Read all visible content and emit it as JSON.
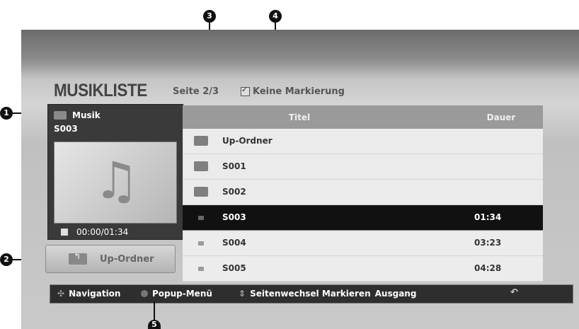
{
  "screen": {
    "title": "MUSIKLISTE",
    "page_info": "Seite 2/3",
    "mark_info": "Keine Markierung"
  },
  "preview": {
    "category": "Musik",
    "track": "S003",
    "time": "00:00/01:34"
  },
  "up_button": {
    "label": "Up-Ordner"
  },
  "list": {
    "headers": {
      "title": "Titel",
      "duration": "Dauer"
    },
    "rows": [
      {
        "name": "Up-Ordner",
        "duration": "",
        "icon": "up-folder"
      },
      {
        "name": "S001",
        "duration": "",
        "icon": "folder"
      },
      {
        "name": "S002",
        "duration": "",
        "icon": "folder"
      },
      {
        "name": "S003",
        "duration": "01:34",
        "icon": "file",
        "selected": true
      },
      {
        "name": "S004",
        "duration": "03:23",
        "icon": "file"
      },
      {
        "name": "S005",
        "duration": "04:28",
        "icon": "file"
      }
    ]
  },
  "helpbar": {
    "navigation": "Navigation",
    "popup_menu": "Popup-Menü",
    "page_switch": "Seitenwechsel Markieren",
    "exit": "Ausgang"
  },
  "callouts": [
    "1",
    "2",
    "3",
    "4",
    "5"
  ]
}
